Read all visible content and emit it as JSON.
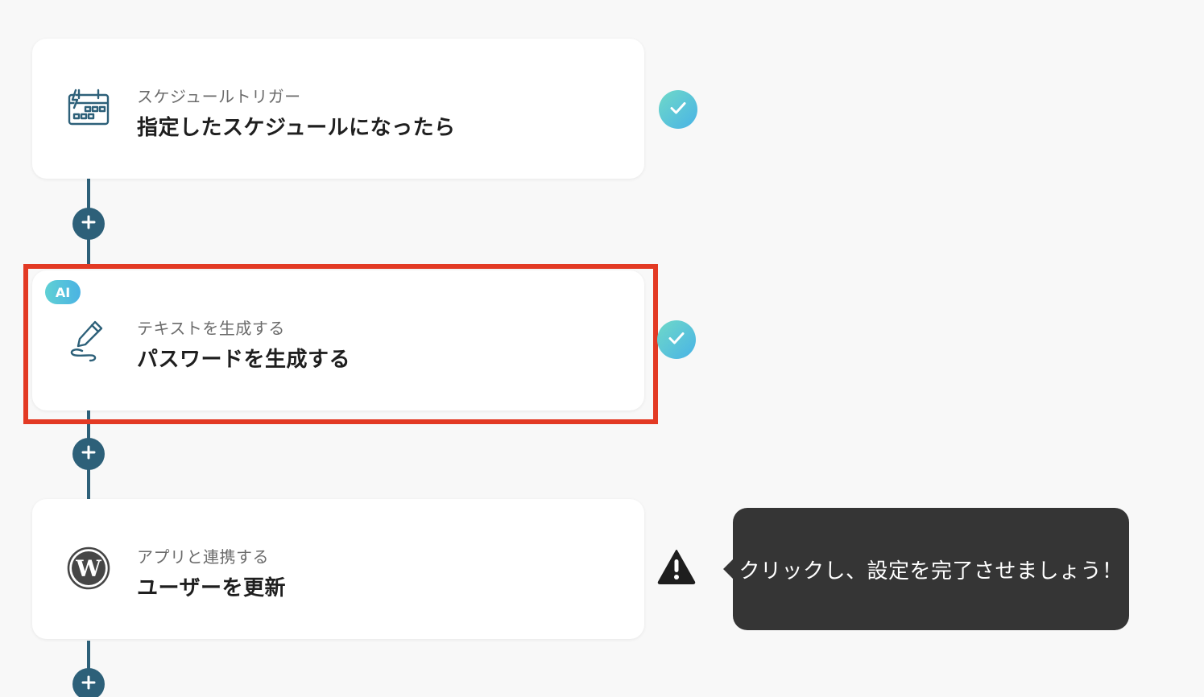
{
  "flow": {
    "steps": [
      {
        "subtitle": "スケジュールトリガー",
        "title": "指定したスケジュールになったら",
        "icon": "schedule-calendar-icon",
        "status": "complete"
      },
      {
        "badge": "AI",
        "subtitle": "テキストを生成する",
        "title": "パスワードを生成する",
        "icon": "pen-generate-icon",
        "status": "complete",
        "highlighted": true
      },
      {
        "subtitle": "アプリと連携する",
        "title": "ユーザーを更新",
        "icon": "wordpress-icon",
        "status": "warning"
      }
    ],
    "add_button_icon": "plus-icon"
  },
  "tooltip": {
    "text": "クリックし、設定を完了させましょう！"
  },
  "colors": {
    "connector": "#2d6079",
    "highlight": "#e33a24",
    "check_gradient": [
      "#6fd9c8",
      "#49b3e6"
    ],
    "tooltip_bg": "#353535"
  }
}
